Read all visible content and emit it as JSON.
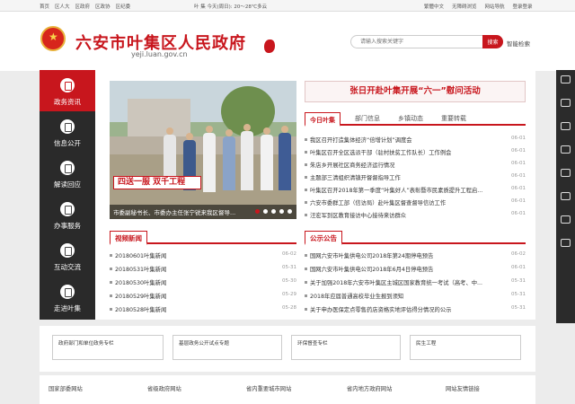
{
  "topbar": {
    "links": [
      "首页",
      "区人大",
      "区政府",
      "区政协",
      "区纪委"
    ],
    "date": "叶 集 今天(周日): 20～28℃多云",
    "right": [
      "繁體中文",
      "无障碍浏览",
      "网站导航",
      "登录登录"
    ]
  },
  "header": {
    "title": "六安市叶集区人民政府",
    "url": "yeji.luan.gov.cn",
    "search_placeholder": "请输入搜索关键字",
    "search_button": "搜索",
    "smart_search": "智能检索"
  },
  "leftnav": {
    "items": [
      {
        "label": "政务资讯",
        "icon": "news-icon",
        "active": true
      },
      {
        "label": "信息公开",
        "icon": "info-icon"
      },
      {
        "label": "解读回应",
        "icon": "interpret-icon"
      },
      {
        "label": "办事服务",
        "icon": "service-icon"
      },
      {
        "label": "互动交流",
        "icon": "interaction-icon"
      },
      {
        "label": "走进叶集",
        "icon": "yeji-icon"
      }
    ]
  },
  "slideshow": {
    "sign_text": "四送一服 双千工程",
    "caption": "市委副秘书长、市委办主任张宁锐来我区督导..."
  },
  "headline": "张日开赴叶集开展“六一”慰问活动",
  "tabs": [
    "今日叶集",
    "部门信息",
    "乡镇动态",
    "重要转载"
  ],
  "news": [
    {
      "title": "我区召开打造集体经济“倍增计划”调度会",
      "date": "06-01"
    },
    {
      "title": "叶集区召开全区选派干部（驻村扶贫工作队长）工作例会",
      "date": "06-01"
    },
    {
      "title": "朱店乡开展社区商务经济运行情况",
      "date": "06-01"
    },
    {
      "title": "主题部三清组织清镇开督督指导工作",
      "date": "06-01"
    },
    {
      "title": "叶集区召开2018年第一季度“叶集好人”表彰暨市民素质提升工程启...",
      "date": "06-01"
    },
    {
      "title": "六安市委群工部（信访局）赴叶集区督查督导信访工作",
      "date": "06-01"
    },
    {
      "title": "汪宏军到区教育接访中心接待来访群众",
      "date": "06-01"
    }
  ],
  "video_news": {
    "title": "视频新闻",
    "items": [
      {
        "title": "20180601叶集新闻",
        "date": "06-02"
      },
      {
        "title": "20180531叶集新闻",
        "date": "05-31"
      },
      {
        "title": "20180530叶集新闻",
        "date": "05-30"
      },
      {
        "title": "20180529叶集新闻",
        "date": "05-29"
      },
      {
        "title": "20180528叶集新闻",
        "date": "05-28"
      }
    ]
  },
  "notices": {
    "title": "公示公告",
    "items": [
      {
        "title": "国网六安市叶集供电公司2018年第24期停电预告",
        "date": "06-02"
      },
      {
        "title": "国网六安市叶集供电公司2018年6月4日停电预告",
        "date": "06-01"
      },
      {
        "title": "关于加强2018年六安市叶集区主城区国家教育统一考试（高考、中...",
        "date": "05-31"
      },
      {
        "title": "2018年应届普通高校毕业生报到须知",
        "date": "05-31"
      },
      {
        "title": "关于申办医保定点零售药店资格实地评估得分情况的公示",
        "date": "05-31"
      }
    ]
  },
  "dropdowns": [
    "政府部门和单位政务专栏",
    "基层政务公开试点专题",
    "环保督查专栏",
    "民生工程"
  ],
  "footer_links": [
    "国家部委网站",
    "省级政府网站",
    "省内重要城市网站",
    "省内地方政府网站",
    "网站友情链接"
  ],
  "colors": {
    "brand_red": "#c8161d",
    "nav_dark": "#2a2a2a"
  }
}
